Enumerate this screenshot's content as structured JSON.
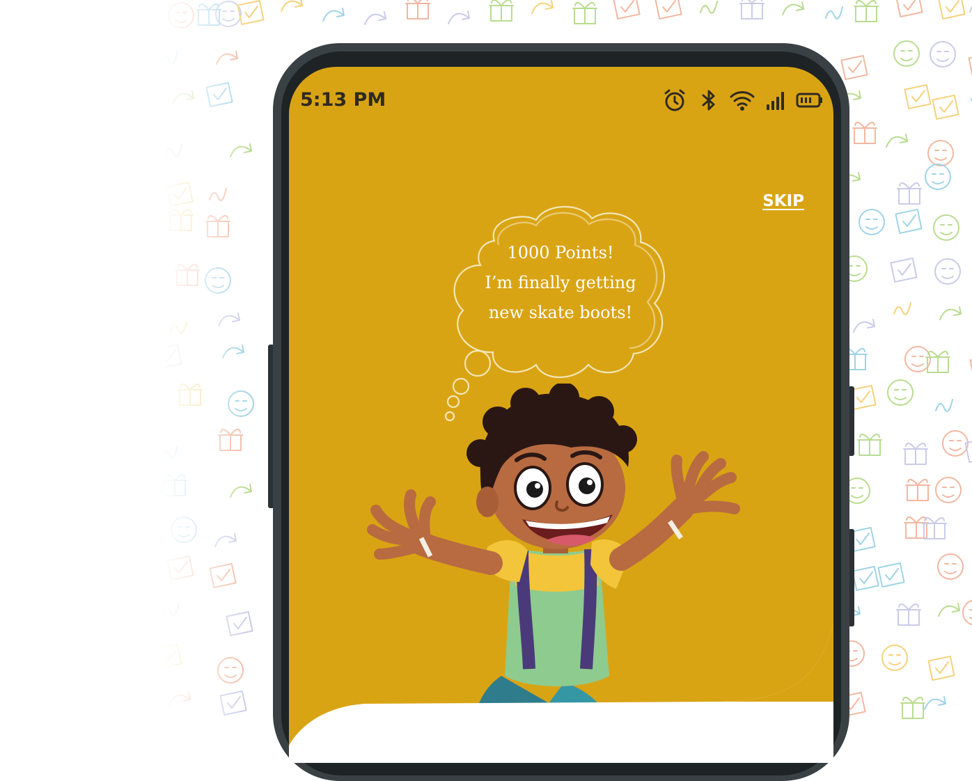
{
  "status_bar": {
    "time": "5:13 PM",
    "icons": [
      "alarm-icon",
      "bluetooth-icon",
      "wifi-icon",
      "signal-icon",
      "battery-icon"
    ]
  },
  "onboarding": {
    "skip_label": "SKIP",
    "thought_lines": [
      "1000 Points!",
      "I’m finally getting",
      "new skate boots!"
    ],
    "illustration": "excited-boy-jumping",
    "background_color": "#d9a414"
  },
  "colors": {
    "screen_bg": "#d9a414",
    "phone_frame": "#3a4144",
    "text_light": "#ffffff",
    "status_text": "#2e2a22"
  }
}
